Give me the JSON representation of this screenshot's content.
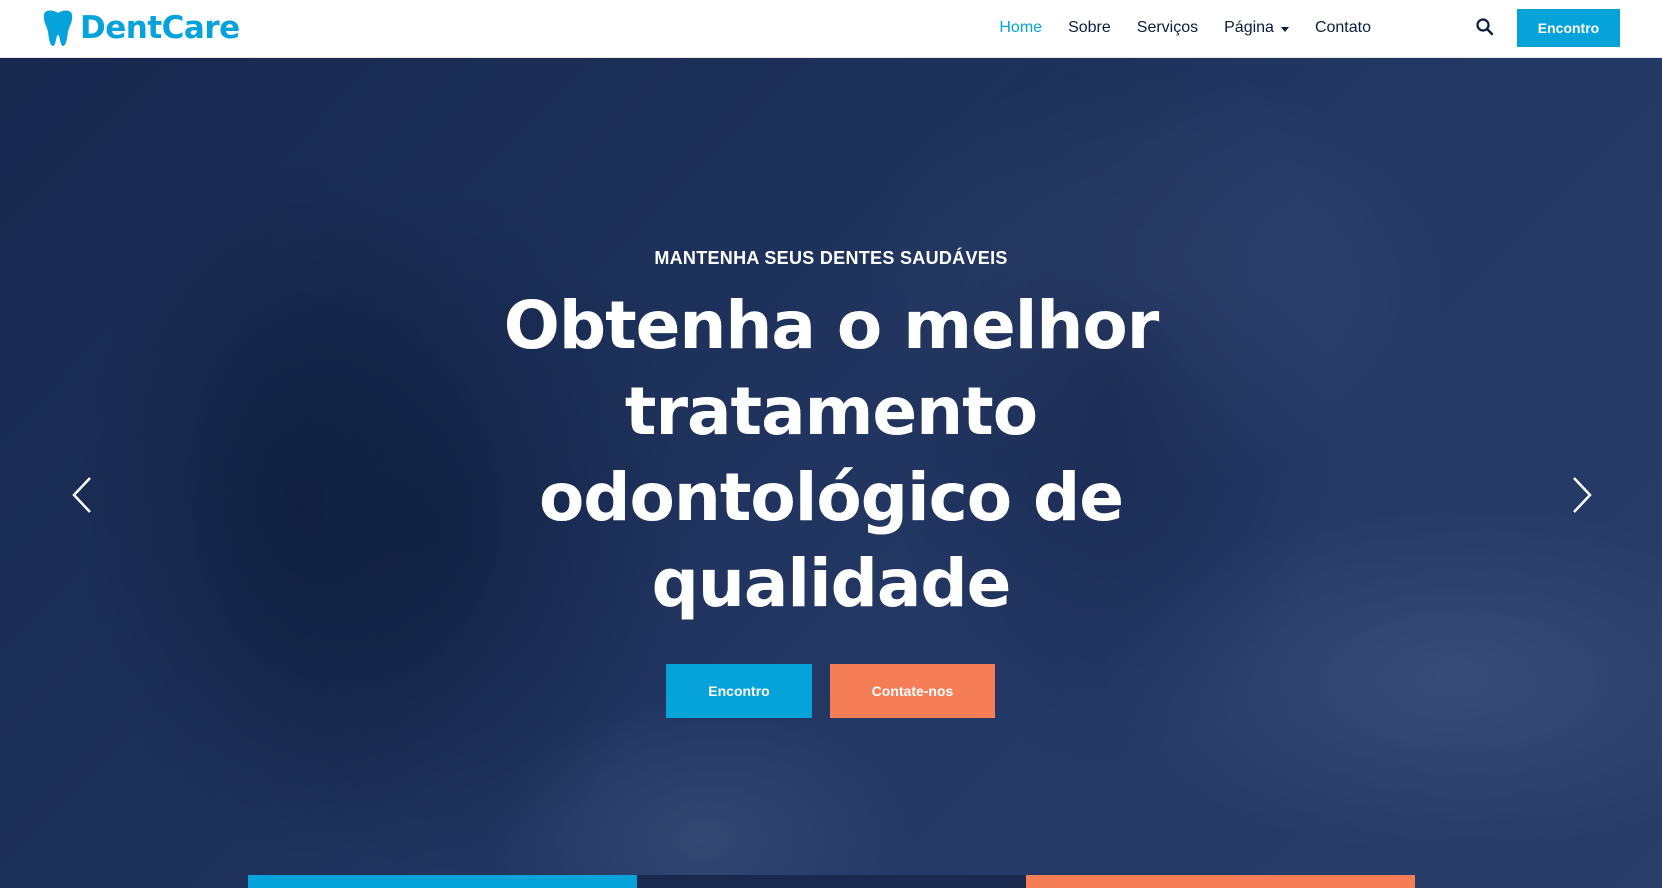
{
  "brand": {
    "name": "DentCare",
    "icon": "tooth-icon",
    "color": "#06A3DA"
  },
  "nav": {
    "items": [
      {
        "label": "Home",
        "active": true
      },
      {
        "label": "Sobre",
        "active": false
      },
      {
        "label": "Serviços",
        "active": false
      },
      {
        "label": "Página",
        "active": false,
        "dropdown": true
      },
      {
        "label": "Contato",
        "active": false
      }
    ],
    "search_icon": "search-icon",
    "cta_label": "Encontro"
  },
  "hero": {
    "kicker": "MANTENHA SEUS DENTES SAUDÁVEIS",
    "title": "Obtenha o melhor tratamento odontológico de qualidade",
    "primary_button": "Encontro",
    "secondary_button": "Contate-nos",
    "prev_icon": "chevron-left-icon",
    "next_icon": "chevron-right-icon"
  },
  "colors": {
    "primary": "#06A3DA",
    "secondary": "#F57E57",
    "dark": "#091E3E"
  }
}
